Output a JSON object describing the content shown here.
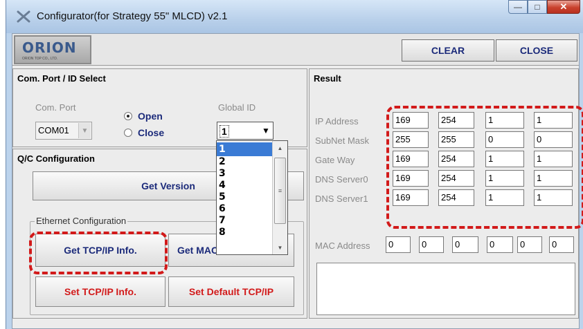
{
  "window": {
    "title": "Configurator(for Strategy 55\" MLCD) v2.1"
  },
  "logo": {
    "main": "ORION",
    "sub": "ORION TOP CO., LTD."
  },
  "toolbar": {
    "clear_label": "CLEAR",
    "close_label": "CLOSE"
  },
  "com_port": {
    "title": "Com. Port / ID Select",
    "port_label": "Com. Port",
    "port_value": "COM01",
    "open_label": "Open",
    "close_label": "Close",
    "global_id_label": "Global ID",
    "global_id_value": "1",
    "dropdown_options": [
      "1",
      "2",
      "3",
      "4",
      "5",
      "6",
      "7",
      "8"
    ]
  },
  "qc": {
    "title": "Q/C Configuration",
    "get_version_label": "Get Version",
    "ethernet_group_label": "Ethernet Configuration",
    "get_tcpip_label": "Get TCP/IP Info.",
    "get_mac_label": "Get MAC",
    "set_tcpip_label": "Set TCP/IP Info.",
    "set_default_label": "Set Default TCP/IP"
  },
  "result": {
    "title": "Result",
    "rows": [
      {
        "label": "IP Address",
        "values": [
          "169",
          "254",
          "1",
          "1"
        ]
      },
      {
        "label": "SubNet Mask",
        "values": [
          "255",
          "255",
          "0",
          "0"
        ]
      },
      {
        "label": "Gate Way",
        "values": [
          "169",
          "254",
          "1",
          "1"
        ]
      },
      {
        "label": "DNS Server0",
        "values": [
          "169",
          "254",
          "1",
          "1"
        ]
      },
      {
        "label": "DNS Server1",
        "values": [
          "169",
          "254",
          "1",
          "1"
        ]
      }
    ],
    "mac_label": "MAC Address",
    "mac_values": [
      "0",
      "0",
      "0",
      "0",
      "0",
      "0"
    ]
  },
  "colors": {
    "highlight": "#d21a1a",
    "button_text": "#1b2a7a"
  }
}
